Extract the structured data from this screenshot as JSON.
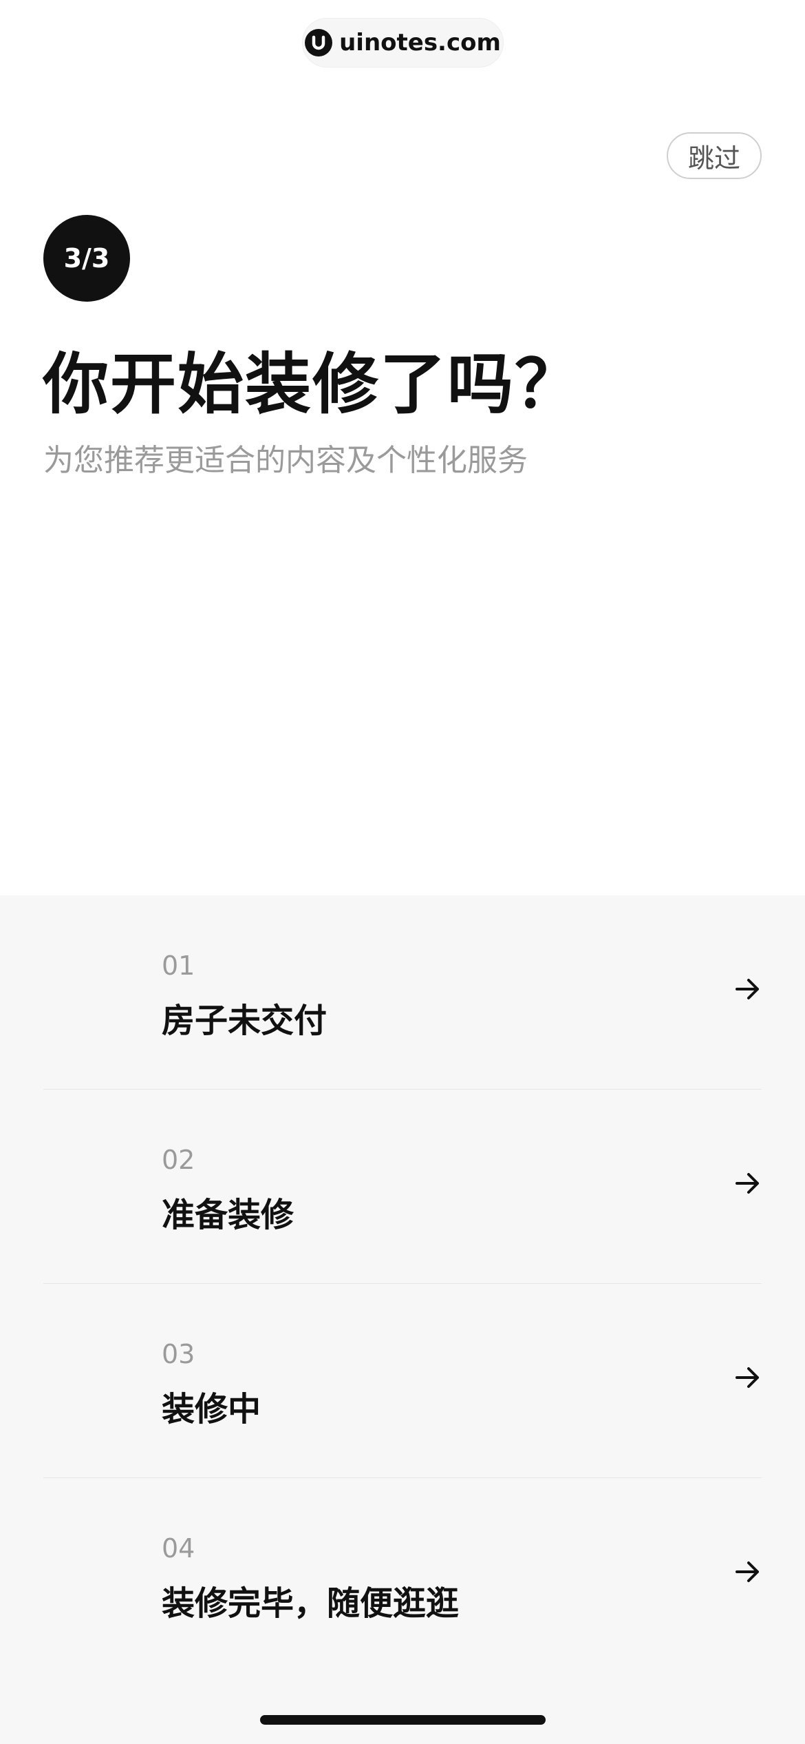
{
  "watermark": {
    "text": "uinotes.com",
    "logo_icon": "uinotes-logo-icon"
  },
  "header": {
    "skip_label": "跳过"
  },
  "intro": {
    "step": "3/3",
    "title": "你开始装修了吗？",
    "subtitle": "为您推荐更适合的内容及个性化服务"
  },
  "options": [
    {
      "num": "01",
      "label": "房子未交付",
      "icon": "arrow-right-icon"
    },
    {
      "num": "02",
      "label": "准备装修",
      "icon": "arrow-right-icon"
    },
    {
      "num": "03",
      "label": "装修中",
      "icon": "arrow-right-icon"
    },
    {
      "num": "04",
      "label": "装修完毕，随便逛逛",
      "icon": "arrow-right-icon"
    }
  ],
  "colors": {
    "background": "#ffffff",
    "list_background": "#f7f7f7",
    "primary_text": "#111111",
    "secondary_text": "#9a9a9a"
  }
}
